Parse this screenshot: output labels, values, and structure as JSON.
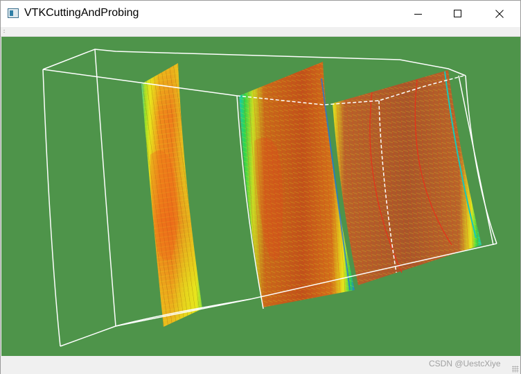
{
  "window": {
    "title": "VTKCuttingAndProbing",
    "controls": {
      "minimize_icon": "minimize-icon",
      "maximize_icon": "maximize-icon",
      "close_icon": "close-icon"
    }
  },
  "viewport": {
    "background_color": "#4e944a",
    "outline_color": "#ffffff",
    "colormap": [
      "#1e5bd6",
      "#19c7b8",
      "#2fd64a",
      "#e7e61c",
      "#f08a1a",
      "#e8301a"
    ]
  },
  "statusbar": {
    "watermark": "CSDN @UestcXiye"
  }
}
